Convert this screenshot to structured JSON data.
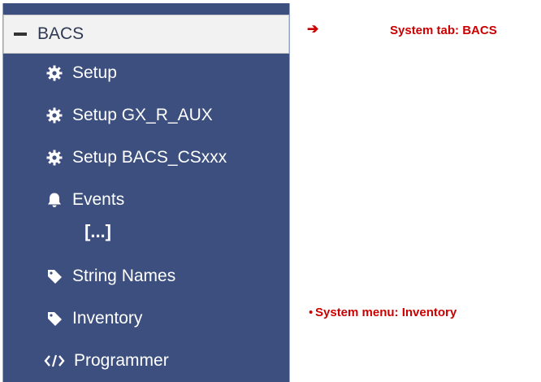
{
  "sidebar": {
    "header": {
      "label": "BACS",
      "icon": "minus-icon"
    },
    "items": [
      {
        "label": "Setup",
        "icon": "gear-icon"
      },
      {
        "label": "Setup GX_R_AUX",
        "icon": "gear-icon"
      },
      {
        "label": "Setup BACS_CSxxx",
        "icon": "gear-icon"
      },
      {
        "label": "Events",
        "icon": "bell-icon"
      },
      {
        "label": "String Names",
        "icon": "tag-icon"
      },
      {
        "label": "Inventory",
        "icon": "tag-icon"
      },
      {
        "label": "Programmer",
        "icon": "code-icon"
      }
    ],
    "ellipsis": "[...]"
  },
  "annotations": {
    "arrow": "➔",
    "system_tab": "System tab: BACS",
    "system_menu_bullet": "•",
    "system_menu": "System menu: Inventory"
  },
  "colors": {
    "sidebar_bg": "#3c4f7e",
    "header_bg": "#f2f2f2",
    "annotation": "#cc0000"
  }
}
